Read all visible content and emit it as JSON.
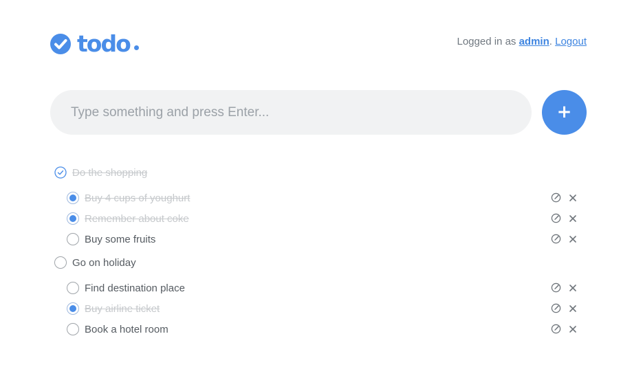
{
  "header": {
    "logo_text": "todo",
    "logged_in_prefix": "Logged in as ",
    "username": "admin",
    "separator": ".",
    "logout_label": "Logout"
  },
  "input": {
    "placeholder": "Type something and press Enter...",
    "value": "",
    "add_label": "+"
  },
  "colors": {
    "accent": "#4a8de8",
    "done_text": "#c6c9cc",
    "input_bg": "#f1f2f3"
  },
  "todos": [
    {
      "label": "Do the shopping",
      "done": true,
      "children": [
        {
          "label": "Buy 4 cups of youghurt",
          "done": true
        },
        {
          "label": "Remember about coke",
          "done": true
        },
        {
          "label": "Buy some fruits",
          "done": false
        }
      ]
    },
    {
      "label": "Go on holiday",
      "done": false,
      "children": [
        {
          "label": "Find destination place",
          "done": false
        },
        {
          "label": "Buy airline ticket",
          "done": true
        },
        {
          "label": "Book a hotel room",
          "done": false
        }
      ]
    }
  ],
  "icons": {
    "edit": "edit-check-icon",
    "delete": "close-icon",
    "parent_done": "check-circle-icon"
  }
}
